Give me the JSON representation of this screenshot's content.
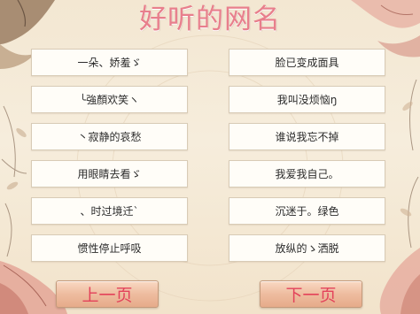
{
  "page": {
    "title": "好听的网名"
  },
  "names": {
    "left": [
      "一朵、娇羞ゞ",
      "╰強顏欢笑ヽ",
      "丶寂静的哀愁",
      "用眼睛去看ゞ",
      "、时过境迁`",
      "惯性停止呼吸"
    ],
    "right": [
      "脸已变成面具",
      "我叫没烦恼ŋ",
      "谁说我忘不掉",
      "我爱我自己。",
      "沉迷于。绿色",
      "放纵的ゝ洒脱"
    ]
  },
  "nav": {
    "prev_label": "上一页",
    "next_label": "下一页"
  },
  "colors": {
    "title": "#e87f8c",
    "button_text": "#e3425a",
    "background": "#f5ead8"
  }
}
